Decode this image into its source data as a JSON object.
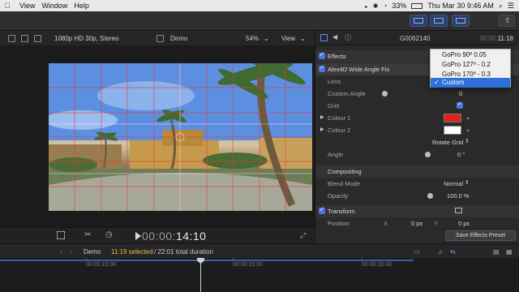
{
  "menubar": {
    "app_items": [
      "View",
      "Window",
      "Help"
    ],
    "battery": "33%",
    "clock": "Thu Mar 30  9:46 AM"
  },
  "viewer": {
    "format": "1080p HD 30p, Stereo",
    "project": "Demo",
    "zoom": "54%",
    "view_menu": "View"
  },
  "transport": {
    "timecode_dim": "00:00:",
    "timecode_bright": "14:10"
  },
  "inspector": {
    "clip_name": "G0062140",
    "duration_dim": "00:00:",
    "duration_bright": "11:18",
    "effects_label": "Effects",
    "effect_name": "Alex4D Wide Angle Fix",
    "lens_label": "Lens",
    "custom_angle_label": "Custom Angle",
    "custom_angle_value": "0",
    "grid_label": "Grid",
    "colour1_label": "Colour 1",
    "colour2_label": "Colour 2",
    "rotate_grid": "Rotate Grid",
    "angle_label": "Angle",
    "angle_value": "0 °",
    "compositing_label": "Compositing",
    "blend_mode_label": "Blend Mode",
    "blend_mode_value": "Normal",
    "opacity_label": "Opacity",
    "opacity_value": "100.0 %",
    "transform_label": "Transform",
    "position_label": "Position",
    "pos_x_label": "X",
    "pos_x_value": "0 px",
    "pos_y_label": "Y",
    "pos_y_value": "0 px",
    "save_preset": "Save Effects Preset"
  },
  "lens_menu": {
    "options": [
      "GoPro 90º 0.05",
      "GoPro 127º - 0.2",
      "GoPro 170º - 0.3",
      "Custom"
    ],
    "selected": "Custom"
  },
  "timeline": {
    "project": "Demo",
    "selected_text": "11:19 selected",
    "total_text": " / 22:01 total duration",
    "ruler_labels": [
      "00:00:10:00",
      "00:00:15:00",
      "00:00:20:00"
    ]
  },
  "colors": {
    "colour1": "#e0201c",
    "colour2": "#ffffff",
    "accent": "#4a78e0",
    "grid_lines": "#e23b3b"
  }
}
